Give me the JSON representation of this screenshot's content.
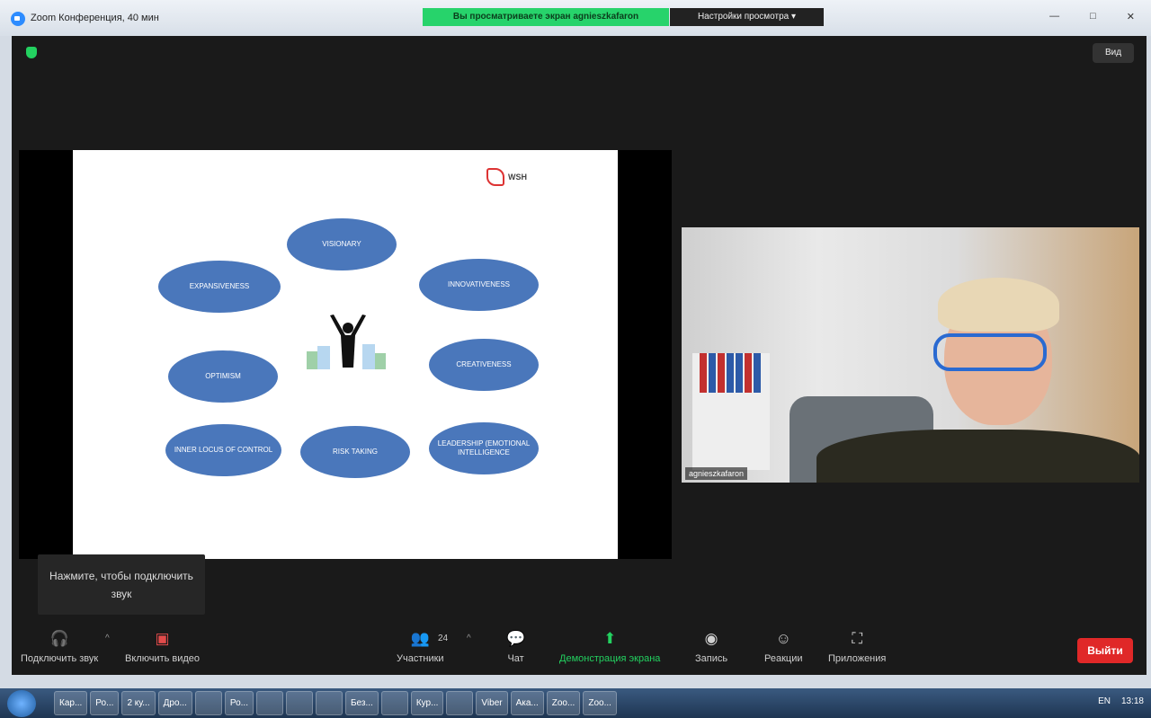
{
  "window": {
    "title": "Zoom Конференция, 40 мин",
    "share_banner": "Вы просматриваете экран agnieszkafaron",
    "view_options": "Настройки просмотра ▾",
    "controls": [
      "—",
      "□",
      "✕"
    ]
  },
  "header": {
    "view_button": "Вид"
  },
  "slide": {
    "logo_text": "WSH",
    "ellipses": [
      "VISIONARY",
      "EXPANSIVENESS",
      "INNOVATIVENESS",
      "OPTIMISM",
      "CREATIVENESS",
      "INNER LOCUS OF CONTROL",
      "RISK TAKING",
      "LEADERSHIP (EMOTIONAL INTELLIGENCE"
    ]
  },
  "video": {
    "participant_name": "agnieszkafaron"
  },
  "tooltip": {
    "text": "Нажмите, чтобы подключить звук"
  },
  "toolbar": {
    "audio": "Подключить звук",
    "video": "Включить видео",
    "participants": "Участники",
    "participants_count": "24",
    "chat": "Чат",
    "share": "Демонстрация экрана",
    "record": "Запись",
    "reactions": "Реакции",
    "apps": "Приложения",
    "leave": "Выйти"
  },
  "taskbar": {
    "tasks": [
      "Кар...",
      "Ро...",
      "2 ку...",
      "Дро...",
      "",
      "Ро...",
      "",
      "",
      "",
      "Без...",
      "",
      "Кур...",
      "",
      "Viber",
      "Ака...",
      "Zoo...",
      "Zoo..."
    ],
    "lang": "EN",
    "time": "13:18"
  },
  "colors": {
    "accent_green": "#23d160",
    "leave_red": "#e02828",
    "ellipse_blue": "#4a77bb"
  }
}
